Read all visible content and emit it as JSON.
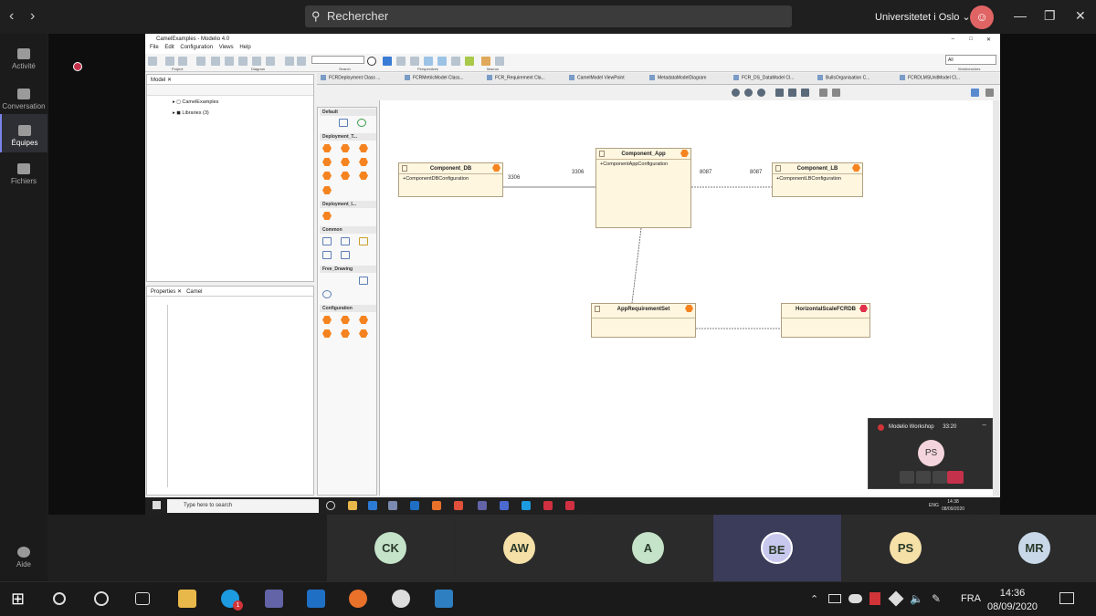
{
  "teams": {
    "search_placeholder": "Rechercher",
    "org_name": "Universitetet i Oslo",
    "rail": [
      {
        "label": "Activité"
      },
      {
        "label": "Conversation"
      },
      {
        "label": "Équipes"
      },
      {
        "label": "Fichiers"
      },
      {
        "label": "Aide"
      }
    ]
  },
  "modelio": {
    "window_title": "CamelExamples - Modelio 4.0",
    "menu": [
      "File",
      "Edit",
      "Configuration",
      "Views",
      "Help"
    ],
    "toolbar_groups": [
      "Project",
      "Diagram",
      "Search",
      "Perspectives",
      "Macros"
    ],
    "filter_value": "All",
    "filter_label": "Workbenches",
    "model_tab": "Model",
    "tree": [
      "CamelExamples",
      "Libraries (3)"
    ],
    "props_tabs": [
      "Properties",
      "Camel"
    ],
    "palette_groups": [
      "Default",
      "Deployment_T...",
      "Deployment_I...",
      "Common",
      "Free_Drawing",
      "Configuration"
    ],
    "diagram_tabs": [
      "FCRDeployment Class ...",
      "FCRMetricModel Class...",
      "FCR_Requirement Cla...",
      "CamelModel ViewPoint",
      "MetadataModelDiagram",
      "FCR_DS_DataModel Cl...",
      "BullsOrganisation C...",
      "FCRDLMSUnitModel Cl..."
    ],
    "components": [
      {
        "name": "Component_DB",
        "attr": "+ComponentDBConfiguration"
      },
      {
        "name": "Component_App",
        "attr": "+ComponentAppConfiguration"
      },
      {
        "name": "Component_LB",
        "attr": "+ComponentLBConfiguration"
      },
      {
        "name": "AppRequirementSet",
        "attr": ""
      },
      {
        "name": "HorizontalScaleFCRDB",
        "attr": ""
      }
    ],
    "port_labels": [
      "3306",
      "3306",
      "8087",
      "8087"
    ]
  },
  "inner_taskbar": {
    "search_placeholder": "Type here to search",
    "lang": "ENG",
    "time": "14:38",
    "date": "08/09/2020"
  },
  "mini_call": {
    "title": "Modelio Workshop",
    "duration": "33:20",
    "avatar": "PS"
  },
  "participants": [
    {
      "initials": "CK",
      "color": "#c4e3c8"
    },
    {
      "initials": "AW",
      "color": "#f5e0a8"
    },
    {
      "initials": "A",
      "color": "#c4e3c8"
    },
    {
      "initials": "BE",
      "color": "#c8c8ee"
    },
    {
      "initials": "PS",
      "color": "#f5e0a8"
    },
    {
      "initials": "MR",
      "color": "#c8d8e8"
    }
  ],
  "taskbar": {
    "lang": "FRA",
    "time": "14:36",
    "date": "08/09/2020",
    "skype_badge": "1"
  }
}
